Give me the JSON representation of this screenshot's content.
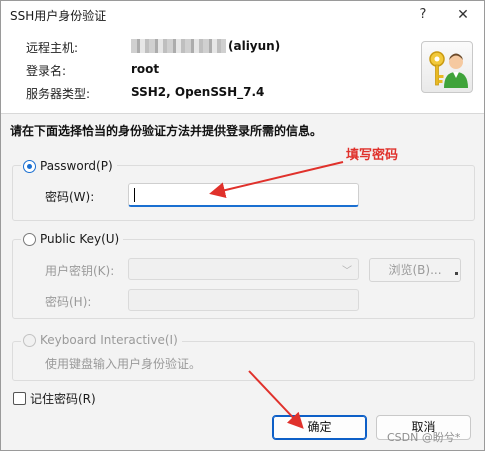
{
  "window": {
    "title": "SSH用户身份验证",
    "help_glyph": "?",
    "close_glyph": "✕"
  },
  "info": {
    "remote_host_label": "远程主机:",
    "remote_host_suffix": "(aliyun)",
    "login_label": "登录名:",
    "login_value": "root",
    "server_type_label": "服务器类型:",
    "server_type_value": "SSH2, OpenSSH_7.4"
  },
  "instruction": "请在下面选择恰当的身份验证方法并提供登录所需的信息。",
  "password_group": {
    "label": "Password(P)",
    "field_label": "密码(W):",
    "value": "",
    "selected": true
  },
  "publickey_group": {
    "label": "Public Key(U)",
    "key_label": "用户密钥(K):",
    "key_value": "",
    "browse_label": "浏览(B)...",
    "passphrase_label": "密码(H):",
    "passphrase_value": ""
  },
  "keyboard_group": {
    "label": "Keyboard Interactive(I)",
    "description": "使用键盘输入用户身份验证。"
  },
  "remember_label": "记住密码(R)",
  "buttons": {
    "ok": "确定",
    "cancel": "取消"
  },
  "annotation": "填写密码",
  "watermark": "CSDN @盼兮*",
  "colors": {
    "accent": "#1a6fd1",
    "annotation": "#e0312b"
  }
}
